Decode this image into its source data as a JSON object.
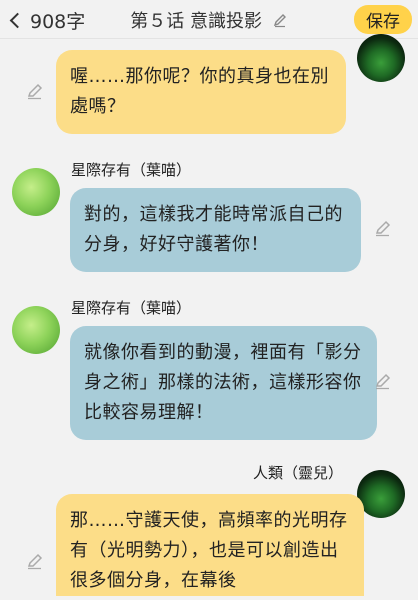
{
  "header": {
    "back_label": "908字",
    "title": "第５话 意識投影",
    "save_label": "保存"
  },
  "messages": [
    {
      "sender": "",
      "text": "喔……那你呢？你的真身也在別處嗎？"
    },
    {
      "sender": "星際存有（葉喵）",
      "text": "對的，這樣我才能時常派自己的分身，好好守護著你！"
    },
    {
      "sender": "星際存有（葉喵）",
      "text": "就像你看到的動漫，裡面有「影分身之術」那樣的法術，這樣形容你比較容易理解！"
    },
    {
      "sender": "人類（靈兒）",
      "text": "那……守護天使，高頻率的光明存有（光明勢力），也是可以創造出很多個分身，在幕後"
    }
  ],
  "colors": {
    "human_bubble": "#fcdd88",
    "star_bubble": "#a8ccd8",
    "save_button": "#ffd24a"
  },
  "icons": [
    "chevron-left-icon",
    "pencil-icon"
  ]
}
